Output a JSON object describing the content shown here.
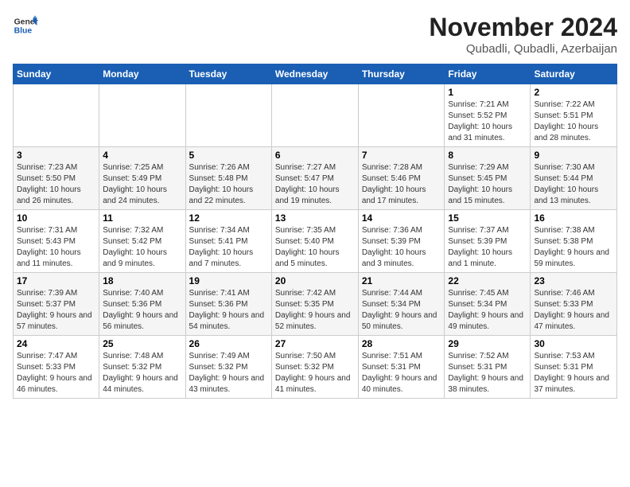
{
  "logo": {
    "line1": "General",
    "line2": "Blue"
  },
  "header": {
    "month_year": "November 2024",
    "location": "Qubadli, Qubadli, Azerbaijan"
  },
  "weekdays": [
    "Sunday",
    "Monday",
    "Tuesday",
    "Wednesday",
    "Thursday",
    "Friday",
    "Saturday"
  ],
  "weeks": [
    [
      {
        "day": "",
        "info": ""
      },
      {
        "day": "",
        "info": ""
      },
      {
        "day": "",
        "info": ""
      },
      {
        "day": "",
        "info": ""
      },
      {
        "day": "",
        "info": ""
      },
      {
        "day": "1",
        "info": "Sunrise: 7:21 AM\nSunset: 5:52 PM\nDaylight: 10 hours and 31 minutes."
      },
      {
        "day": "2",
        "info": "Sunrise: 7:22 AM\nSunset: 5:51 PM\nDaylight: 10 hours and 28 minutes."
      }
    ],
    [
      {
        "day": "3",
        "info": "Sunrise: 7:23 AM\nSunset: 5:50 PM\nDaylight: 10 hours and 26 minutes."
      },
      {
        "day": "4",
        "info": "Sunrise: 7:25 AM\nSunset: 5:49 PM\nDaylight: 10 hours and 24 minutes."
      },
      {
        "day": "5",
        "info": "Sunrise: 7:26 AM\nSunset: 5:48 PM\nDaylight: 10 hours and 22 minutes."
      },
      {
        "day": "6",
        "info": "Sunrise: 7:27 AM\nSunset: 5:47 PM\nDaylight: 10 hours and 19 minutes."
      },
      {
        "day": "7",
        "info": "Sunrise: 7:28 AM\nSunset: 5:46 PM\nDaylight: 10 hours and 17 minutes."
      },
      {
        "day": "8",
        "info": "Sunrise: 7:29 AM\nSunset: 5:45 PM\nDaylight: 10 hours and 15 minutes."
      },
      {
        "day": "9",
        "info": "Sunrise: 7:30 AM\nSunset: 5:44 PM\nDaylight: 10 hours and 13 minutes."
      }
    ],
    [
      {
        "day": "10",
        "info": "Sunrise: 7:31 AM\nSunset: 5:43 PM\nDaylight: 10 hours and 11 minutes."
      },
      {
        "day": "11",
        "info": "Sunrise: 7:32 AM\nSunset: 5:42 PM\nDaylight: 10 hours and 9 minutes."
      },
      {
        "day": "12",
        "info": "Sunrise: 7:34 AM\nSunset: 5:41 PM\nDaylight: 10 hours and 7 minutes."
      },
      {
        "day": "13",
        "info": "Sunrise: 7:35 AM\nSunset: 5:40 PM\nDaylight: 10 hours and 5 minutes."
      },
      {
        "day": "14",
        "info": "Sunrise: 7:36 AM\nSunset: 5:39 PM\nDaylight: 10 hours and 3 minutes."
      },
      {
        "day": "15",
        "info": "Sunrise: 7:37 AM\nSunset: 5:39 PM\nDaylight: 10 hours and 1 minute."
      },
      {
        "day": "16",
        "info": "Sunrise: 7:38 AM\nSunset: 5:38 PM\nDaylight: 9 hours and 59 minutes."
      }
    ],
    [
      {
        "day": "17",
        "info": "Sunrise: 7:39 AM\nSunset: 5:37 PM\nDaylight: 9 hours and 57 minutes."
      },
      {
        "day": "18",
        "info": "Sunrise: 7:40 AM\nSunset: 5:36 PM\nDaylight: 9 hours and 56 minutes."
      },
      {
        "day": "19",
        "info": "Sunrise: 7:41 AM\nSunset: 5:36 PM\nDaylight: 9 hours and 54 minutes."
      },
      {
        "day": "20",
        "info": "Sunrise: 7:42 AM\nSunset: 5:35 PM\nDaylight: 9 hours and 52 minutes."
      },
      {
        "day": "21",
        "info": "Sunrise: 7:44 AM\nSunset: 5:34 PM\nDaylight: 9 hours and 50 minutes."
      },
      {
        "day": "22",
        "info": "Sunrise: 7:45 AM\nSunset: 5:34 PM\nDaylight: 9 hours and 49 minutes."
      },
      {
        "day": "23",
        "info": "Sunrise: 7:46 AM\nSunset: 5:33 PM\nDaylight: 9 hours and 47 minutes."
      }
    ],
    [
      {
        "day": "24",
        "info": "Sunrise: 7:47 AM\nSunset: 5:33 PM\nDaylight: 9 hours and 46 minutes."
      },
      {
        "day": "25",
        "info": "Sunrise: 7:48 AM\nSunset: 5:32 PM\nDaylight: 9 hours and 44 minutes."
      },
      {
        "day": "26",
        "info": "Sunrise: 7:49 AM\nSunset: 5:32 PM\nDaylight: 9 hours and 43 minutes."
      },
      {
        "day": "27",
        "info": "Sunrise: 7:50 AM\nSunset: 5:32 PM\nDaylight: 9 hours and 41 minutes."
      },
      {
        "day": "28",
        "info": "Sunrise: 7:51 AM\nSunset: 5:31 PM\nDaylight: 9 hours and 40 minutes."
      },
      {
        "day": "29",
        "info": "Sunrise: 7:52 AM\nSunset: 5:31 PM\nDaylight: 9 hours and 38 minutes."
      },
      {
        "day": "30",
        "info": "Sunrise: 7:53 AM\nSunset: 5:31 PM\nDaylight: 9 hours and 37 minutes."
      }
    ]
  ]
}
